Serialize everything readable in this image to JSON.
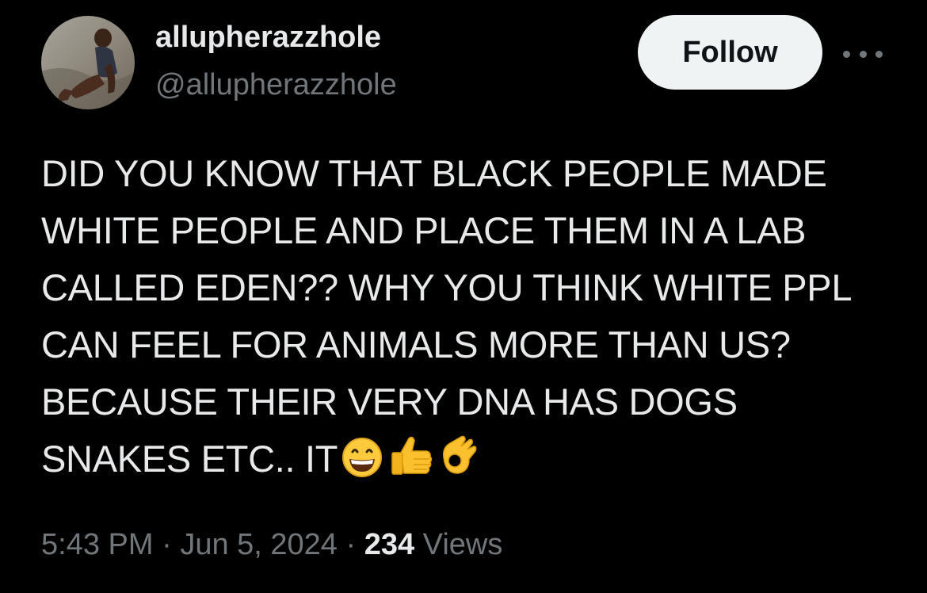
{
  "author": {
    "display_name": "allupherazzhole",
    "handle": "@allupherazzhole"
  },
  "actions": {
    "follow_label": "Follow",
    "more_icon": "more-horizontal-icon"
  },
  "tweet": {
    "lines": [
      "DID YOU KNOW THAT BLACK PEOPLE MADE",
      "WHITE PEOPLE AND PLACE THEM IN A LAB",
      "CALLED EDEN?? WHY YOU THINK WHITE PPL",
      "CAN FEEL FOR ANIMALS MORE THAN US?",
      "BECAUSE THEIR VERY DNA HAS DOGS",
      "SNAKES ETC.. IT"
    ],
    "emojis": [
      "grinning-face-emoji",
      "thumbs-up-emoji",
      "ok-hand-emoji"
    ]
  },
  "meta": {
    "time": "5:43 PM",
    "separator": "·",
    "date": "Jun 5, 2024",
    "views_count": "234",
    "views_label": "Views"
  },
  "colors": {
    "background": "#000000",
    "primary_text": "#e7e9ea",
    "secondary_text": "#71767b",
    "follow_button_bg": "#eff3f4",
    "follow_button_text": "#0f1419"
  }
}
